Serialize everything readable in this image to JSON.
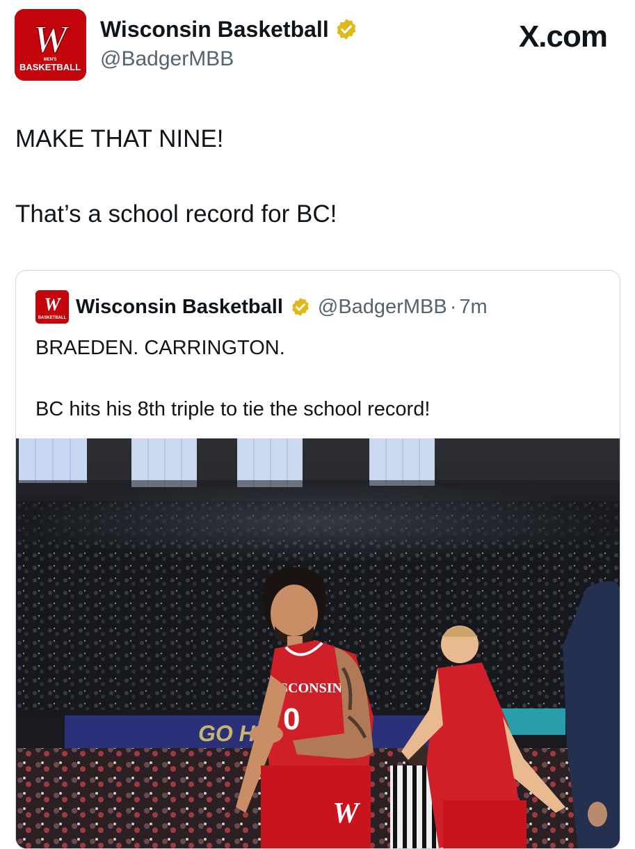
{
  "post": {
    "author_name": "Wisconsin Basketball",
    "author_handle": "@BadgerMBB",
    "site_label": "X.com",
    "lines": [
      "MAKE THAT NINE!",
      "That’s a school record for BC!"
    ]
  },
  "avatar": {
    "logo_letter": "W",
    "logo_caption_small": "MEN'S",
    "logo_caption": "BASKETBALL"
  },
  "quoted_post": {
    "author_name": "Wisconsin Basketball",
    "author_handle": "@BadgerMBB",
    "separator": "·",
    "time": "7m",
    "lines": [
      "BRAEDEN. CARRINGTON.",
      "BC hits his 8th triple to tie the school record!"
    ]
  },
  "photo": {
    "jersey_text": "SCONSIN",
    "jersey_number": "0",
    "shorts_letter": "W",
    "banner_text": "GO H"
  },
  "colors": {
    "badger_red": "#c5050c",
    "verified_gold": "#e2b719",
    "text_secondary": "#536471",
    "border": "#cfd9de"
  }
}
